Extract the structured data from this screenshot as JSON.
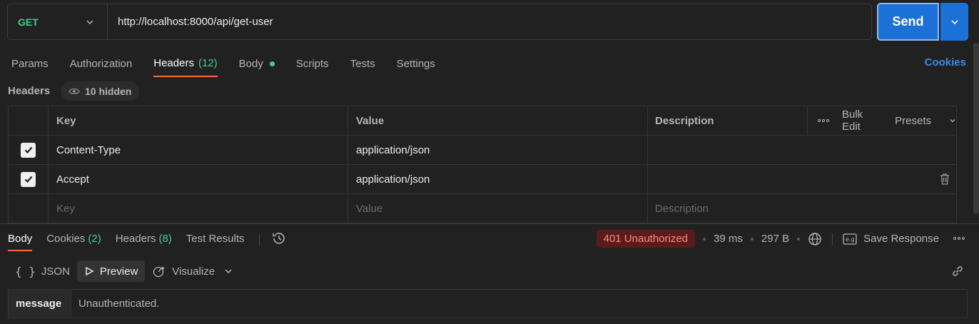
{
  "request": {
    "method": "GET",
    "url": "http://localhost:8000/api/get-user",
    "send_label": "Send"
  },
  "request_tabs": [
    {
      "label": "Params"
    },
    {
      "label": "Authorization"
    },
    {
      "label": "Headers",
      "count": "(12)"
    },
    {
      "label": "Body"
    },
    {
      "label": "Scripts"
    },
    {
      "label": "Tests"
    },
    {
      "label": "Settings"
    }
  ],
  "cookies_link": "Cookies",
  "headers_section": {
    "title": "Headers",
    "hidden_label": "10 hidden",
    "columns": {
      "key": "Key",
      "value": "Value",
      "description": "Description"
    },
    "bulk_edit": "Bulk Edit",
    "presets": "Presets",
    "rows": [
      {
        "key": "Content-Type",
        "value": "application/json",
        "checked": true
      },
      {
        "key": "Accept",
        "value": "application/json",
        "checked": true
      }
    ],
    "placeholders": {
      "key": "Key",
      "value": "Value",
      "description": "Description"
    }
  },
  "response_tabs": [
    {
      "label": "Body"
    },
    {
      "label": "Cookies",
      "count": "(2)"
    },
    {
      "label": "Headers",
      "count": "(8)"
    },
    {
      "label": "Test Results"
    }
  ],
  "response_meta": {
    "status": "401 Unauthorized",
    "time": "39 ms",
    "size": "297 B",
    "save_label": "Save Response"
  },
  "view_modes": {
    "json": "JSON",
    "preview": "Preview",
    "visualize": "Visualize"
  },
  "preview": {
    "key": "message",
    "value": "Unauthenticated."
  },
  "colors": {
    "accent": "#ff6c37",
    "send": "#1c71d8",
    "method_get": "#49cc90",
    "status_error": "#ff8a80"
  }
}
